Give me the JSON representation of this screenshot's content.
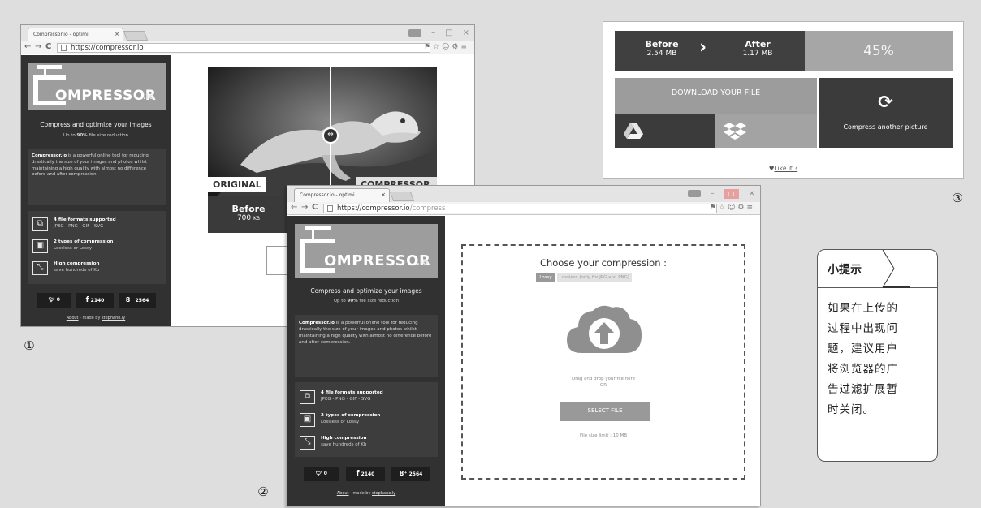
{
  "colors": {
    "sidebar_bg": "#313131",
    "logo_bg": "#9d9d9d",
    "button_gray": "#999999",
    "dark_panel": "#3a3a3a",
    "page_bg": "#dedede"
  },
  "sidebar": {
    "logo_text": "OMPRESSOR",
    "logo_io": ".io",
    "tagline": "Compress and optimize your images",
    "subtag_prefix": "Up to ",
    "subtag_bold": "90%",
    "subtag_suffix": " file size reduction",
    "desc_bold": "Compressor.io",
    "desc_rest": " is a powerful online tool for reducing drastically the size of your images and photos whilst maintaining a high quality with almost no difference before and after compression.",
    "features": [
      {
        "icon": "copy-icon",
        "glyph": "⧉",
        "title": "4 file formats supported",
        "sub": "JPEG - PNG - GIF - SVG"
      },
      {
        "icon": "image-icon",
        "glyph": "▣",
        "title": "2 types of compression",
        "sub": "Lossless or Lossy"
      },
      {
        "icon": "compress-arrows-icon",
        "glyph": "⤡",
        "title": "High compression",
        "sub": "save hundreds of Kb"
      }
    ],
    "social": [
      {
        "icon": "twitter-icon",
        "glyph": "🐦︎",
        "count": "0"
      },
      {
        "icon": "facebook-icon",
        "glyph": "f",
        "count": "2140"
      },
      {
        "icon": "google-plus-icon",
        "glyph": "8⁺",
        "count": "2564"
      }
    ],
    "about_link": "About",
    "made_by": " - made by ",
    "author_link": "stephane.ly"
  },
  "shot1": {
    "tab_title": "Compressor.io - optimi",
    "url": "https://compressor.io",
    "label_original": "ORIGINAL",
    "label_compressor": "COMPRESSOR",
    "before_label": "Before",
    "before_size": "700",
    "before_unit": "KB",
    "marker": "①"
  },
  "shot2": {
    "tab_title": "Compressor.io - optimi",
    "url_main": "https://compressor.io",
    "url_path": "/compress",
    "choose_title": "Choose your compression :",
    "opt_lossy": "Lossy",
    "opt_lossless": "Lossless (only for JPG and PNG)",
    "drag_text": "Drag and drop your file here",
    "or_text": "OR",
    "select_button": "SELECT FILE",
    "size_limit": "File size limit : 10 MB",
    "marker": "②"
  },
  "shot3": {
    "before_label": "Before",
    "before_size": "2.54 MB",
    "after_label": "After",
    "after_size": "1.17 MB",
    "percent": "45%",
    "download_label": "DOWNLOAD YOUR FILE",
    "compress_another": "Compress another picture",
    "like_it": "Like it ?",
    "marker": "③"
  },
  "tip": {
    "title": "小提示",
    "lines": [
      "如果在上传的",
      "过程中出现问",
      "题，建议用户",
      "将浏览器的广",
      "告过滤扩展暂",
      "时关闭。"
    ]
  }
}
